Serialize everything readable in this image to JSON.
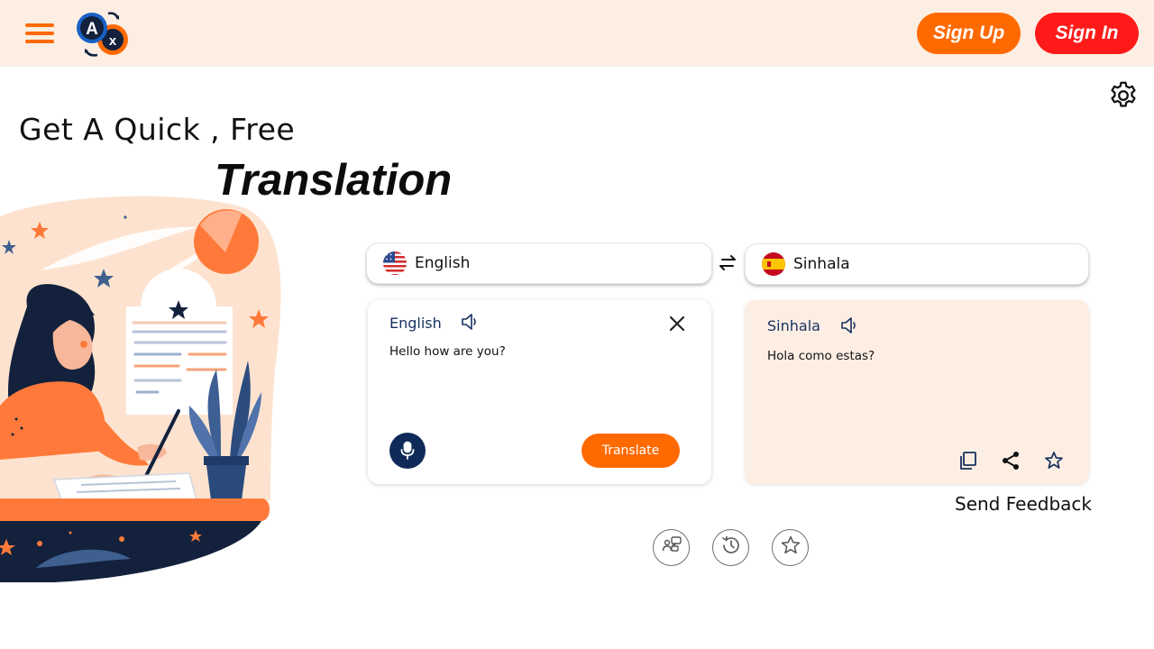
{
  "header": {
    "signup_label": "Sign Up",
    "signin_label": "Sign In",
    "logo_letters": [
      "A",
      "x"
    ]
  },
  "hero": {
    "line1": "Get A Quick , Free",
    "line2": "Translation"
  },
  "source_select": {
    "language": "English",
    "flag": "us-flag-icon"
  },
  "target_select": {
    "language": "Sinhala",
    "flag": "spain-flag-icon"
  },
  "source_card": {
    "language": "English",
    "text": "Hello how are you?",
    "translate_label": "Translate"
  },
  "target_card": {
    "language": "Sinhala",
    "text": "Hola como estas?"
  },
  "feedback_label": "Send Feedback",
  "bottom_icons": [
    "conversation-icon",
    "history-icon",
    "saved-icon"
  ],
  "colors": {
    "accent": "#ff6a00",
    "signin": "#ff1a1a",
    "header_bg": "#fdeee4",
    "navy": "#0f2a58"
  }
}
